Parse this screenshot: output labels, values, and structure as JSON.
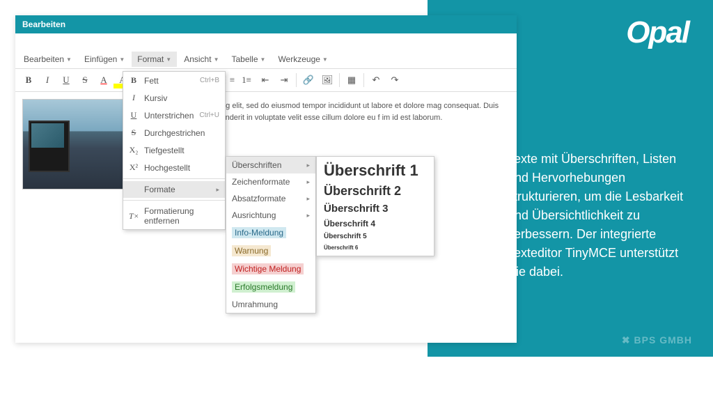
{
  "brand": {
    "logo": "Opal",
    "footer": "BPS GMBH"
  },
  "side_text": "Texte mit Überschriften, Listen und Hervorhebungen strukturieren, um die Lesbarkeit und Übersichtlichkeit zu verbessern. Der integrierte Texteditor TinyMCE unterstützt Sie dabei.",
  "window": {
    "title": "Bearbeiten"
  },
  "menubar": {
    "items": [
      "Bearbeiten",
      "Einfügen",
      "Format",
      "Ansicht",
      "Tabelle",
      "Werkzeuge"
    ],
    "active_index": 2
  },
  "toolbar": {
    "bold": "B",
    "italic": "I",
    "underline": "U",
    "strike": "S",
    "fontcolor": "A",
    "bgcolor": "A"
  },
  "content": {
    "lorem": "met, consectetur adipiscing elit, sed do eiusmod tempor incididunt ut labore et dolore mag consequat. Duis aute irure dolor in reprehenderit in voluptate velit esse cillum dolore eu f im id est laborum."
  },
  "format_menu": {
    "bold": {
      "label": "Fett",
      "shortcut": "Ctrl+B",
      "icon": "B"
    },
    "italic": {
      "label": "Kursiv",
      "icon": "I"
    },
    "underline": {
      "label": "Unterstrichen",
      "shortcut": "Ctrl+U",
      "icon": "U"
    },
    "strike": {
      "label": "Durchgestrichen",
      "icon": "S"
    },
    "sub": {
      "label": "Tiefgestellt",
      "icon": "X₂"
    },
    "sup": {
      "label": "Hochgestellt",
      "icon": "X²"
    },
    "formats": {
      "label": "Formate"
    },
    "clear": {
      "label": "Formatierung entfernen",
      "icon": "T×"
    }
  },
  "formats_submenu": {
    "headings": "Überschriften",
    "inline": "Zeichenformate",
    "blocks": "Absatzformate",
    "align": "Ausrichtung",
    "info": "Info-Meldung",
    "warn": "Warnung",
    "important": "Wichtige Meldung",
    "success": "Erfolgsmeldung",
    "frame": "Umrahmung"
  },
  "headings_submenu": {
    "h1": "Überschrift 1",
    "h2": "Überschrift 2",
    "h3": "Überschrift 3",
    "h4": "Überschrift 4",
    "h5": "Überschrift 5",
    "h6": "Überschrift 6"
  }
}
